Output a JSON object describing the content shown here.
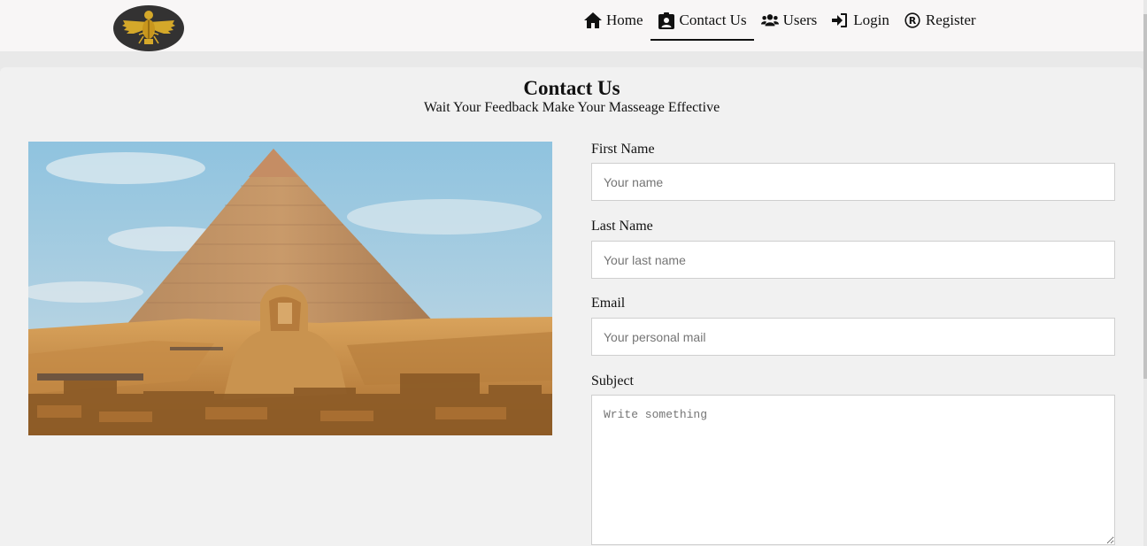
{
  "nav": {
    "items": [
      {
        "label": "Home",
        "icon": "home-icon"
      },
      {
        "label": "Contact Us",
        "icon": "contact-card-icon",
        "active": true
      },
      {
        "label": "Users",
        "icon": "users-icon"
      },
      {
        "label": "Login",
        "icon": "sign-in-icon"
      },
      {
        "label": "Register",
        "icon": "registered-icon"
      }
    ]
  },
  "logo": {
    "icon": "scarab-emblem-logo",
    "color": "#d4a82a"
  },
  "page": {
    "title": "Contact Us",
    "subtitle": "Wait Your Feedback Make Your Masseage Effective"
  },
  "hero": {
    "icon": "pyramid-sphinx-photo"
  },
  "form": {
    "first_name": {
      "label": "First Name",
      "placeholder": "Your name"
    },
    "last_name": {
      "label": "Last Name",
      "placeholder": "Your last name"
    },
    "email": {
      "label": "Email",
      "placeholder": "Your personal mail"
    },
    "subject": {
      "label": "Subject",
      "placeholder": "Write something"
    }
  },
  "colors": {
    "header_bg": "#f8f6f6",
    "panel_bg": "#f1f1f1",
    "logo_bg": "#333232",
    "logo_gold": "#d4a82a"
  }
}
